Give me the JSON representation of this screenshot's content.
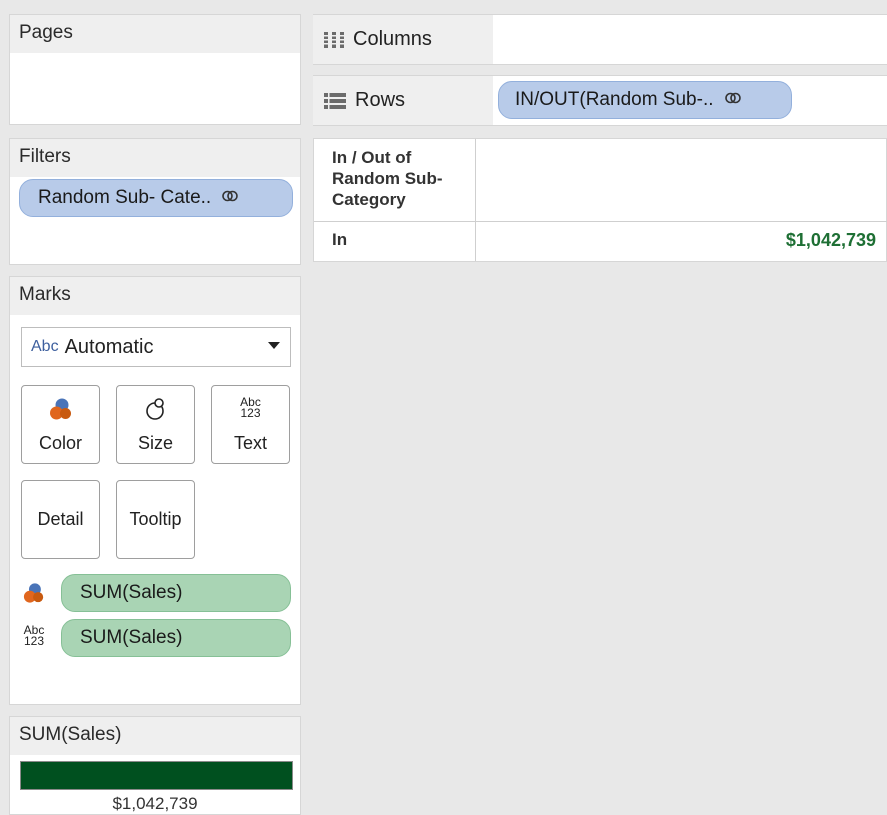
{
  "left_panel": {
    "pages": {
      "title": "Pages"
    },
    "filters": {
      "title": "Filters",
      "pills": [
        {
          "label": "Random Sub- Cate.."
        }
      ]
    },
    "marks": {
      "title": "Marks",
      "mark_type": {
        "icon_text": "Abc",
        "label": "Automatic"
      },
      "buttons": {
        "color": "Color",
        "size": "Size",
        "text": "Text",
        "text_icon_top": "Abc",
        "text_icon_bottom": "123",
        "detail": "Detail",
        "tooltip": "Tooltip"
      },
      "encodings": [
        {
          "icon": "color-icon",
          "label": "SUM(Sales)"
        },
        {
          "icon": "text-icon",
          "icon_top": "Abc",
          "icon_bottom": "123",
          "label": "SUM(Sales)"
        }
      ]
    },
    "legend": {
      "title": "SUM(Sales)",
      "value": "$1,042,739",
      "color": "#00501f"
    }
  },
  "shelves": {
    "columns": {
      "label": "Columns",
      "icon": "columns-icon"
    },
    "rows": {
      "label": "Rows",
      "icon": "rows-icon",
      "pills": [
        {
          "label": "IN/OUT(Random Sub-.."
        }
      ]
    }
  },
  "view": {
    "header": "In / Out of Random Sub-Category",
    "header_lines": [
      "In / Out of",
      "Random Sub-",
      "Category"
    ],
    "rows": [
      {
        "label": "In",
        "value": "$1,042,739"
      }
    ]
  },
  "colors": {
    "filter_pill": "#b8cbe9",
    "measure_pill": "#a9d4b4",
    "value_text": "#1e6f34",
    "legend_bar": "#00501f"
  }
}
